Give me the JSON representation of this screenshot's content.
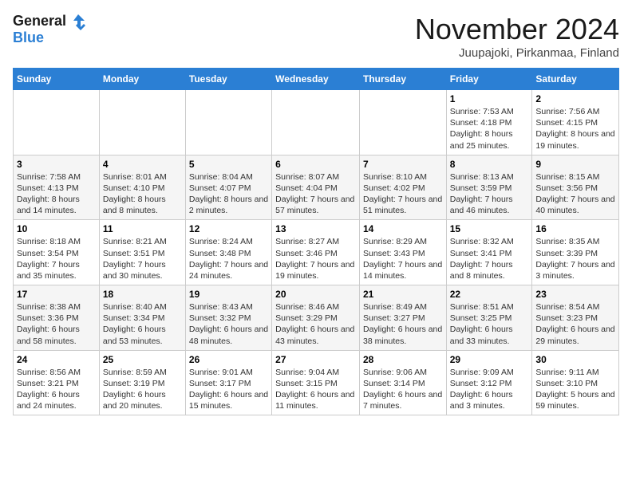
{
  "header": {
    "logo_text_general": "General",
    "logo_text_blue": "Blue",
    "month_title": "November 2024",
    "location": "Juupajoki, Pirkanmaa, Finland"
  },
  "calendar": {
    "days_of_week": [
      "Sunday",
      "Monday",
      "Tuesday",
      "Wednesday",
      "Thursday",
      "Friday",
      "Saturday"
    ],
    "weeks": [
      [
        {
          "day": "",
          "info": ""
        },
        {
          "day": "",
          "info": ""
        },
        {
          "day": "",
          "info": ""
        },
        {
          "day": "",
          "info": ""
        },
        {
          "day": "",
          "info": ""
        },
        {
          "day": "1",
          "info": "Sunrise: 7:53 AM\nSunset: 4:18 PM\nDaylight: 8 hours and 25 minutes."
        },
        {
          "day": "2",
          "info": "Sunrise: 7:56 AM\nSunset: 4:15 PM\nDaylight: 8 hours and 19 minutes."
        }
      ],
      [
        {
          "day": "3",
          "info": "Sunrise: 7:58 AM\nSunset: 4:13 PM\nDaylight: 8 hours and 14 minutes."
        },
        {
          "day": "4",
          "info": "Sunrise: 8:01 AM\nSunset: 4:10 PM\nDaylight: 8 hours and 8 minutes."
        },
        {
          "day": "5",
          "info": "Sunrise: 8:04 AM\nSunset: 4:07 PM\nDaylight: 8 hours and 2 minutes."
        },
        {
          "day": "6",
          "info": "Sunrise: 8:07 AM\nSunset: 4:04 PM\nDaylight: 7 hours and 57 minutes."
        },
        {
          "day": "7",
          "info": "Sunrise: 8:10 AM\nSunset: 4:02 PM\nDaylight: 7 hours and 51 minutes."
        },
        {
          "day": "8",
          "info": "Sunrise: 8:13 AM\nSunset: 3:59 PM\nDaylight: 7 hours and 46 minutes."
        },
        {
          "day": "9",
          "info": "Sunrise: 8:15 AM\nSunset: 3:56 PM\nDaylight: 7 hours and 40 minutes."
        }
      ],
      [
        {
          "day": "10",
          "info": "Sunrise: 8:18 AM\nSunset: 3:54 PM\nDaylight: 7 hours and 35 minutes."
        },
        {
          "day": "11",
          "info": "Sunrise: 8:21 AM\nSunset: 3:51 PM\nDaylight: 7 hours and 30 minutes."
        },
        {
          "day": "12",
          "info": "Sunrise: 8:24 AM\nSunset: 3:48 PM\nDaylight: 7 hours and 24 minutes."
        },
        {
          "day": "13",
          "info": "Sunrise: 8:27 AM\nSunset: 3:46 PM\nDaylight: 7 hours and 19 minutes."
        },
        {
          "day": "14",
          "info": "Sunrise: 8:29 AM\nSunset: 3:43 PM\nDaylight: 7 hours and 14 minutes."
        },
        {
          "day": "15",
          "info": "Sunrise: 8:32 AM\nSunset: 3:41 PM\nDaylight: 7 hours and 8 minutes."
        },
        {
          "day": "16",
          "info": "Sunrise: 8:35 AM\nSunset: 3:39 PM\nDaylight: 7 hours and 3 minutes."
        }
      ],
      [
        {
          "day": "17",
          "info": "Sunrise: 8:38 AM\nSunset: 3:36 PM\nDaylight: 6 hours and 58 minutes."
        },
        {
          "day": "18",
          "info": "Sunrise: 8:40 AM\nSunset: 3:34 PM\nDaylight: 6 hours and 53 minutes."
        },
        {
          "day": "19",
          "info": "Sunrise: 8:43 AM\nSunset: 3:32 PM\nDaylight: 6 hours and 48 minutes."
        },
        {
          "day": "20",
          "info": "Sunrise: 8:46 AM\nSunset: 3:29 PM\nDaylight: 6 hours and 43 minutes."
        },
        {
          "day": "21",
          "info": "Sunrise: 8:49 AM\nSunset: 3:27 PM\nDaylight: 6 hours and 38 minutes."
        },
        {
          "day": "22",
          "info": "Sunrise: 8:51 AM\nSunset: 3:25 PM\nDaylight: 6 hours and 33 minutes."
        },
        {
          "day": "23",
          "info": "Sunrise: 8:54 AM\nSunset: 3:23 PM\nDaylight: 6 hours and 29 minutes."
        }
      ],
      [
        {
          "day": "24",
          "info": "Sunrise: 8:56 AM\nSunset: 3:21 PM\nDaylight: 6 hours and 24 minutes."
        },
        {
          "day": "25",
          "info": "Sunrise: 8:59 AM\nSunset: 3:19 PM\nDaylight: 6 hours and 20 minutes."
        },
        {
          "day": "26",
          "info": "Sunrise: 9:01 AM\nSunset: 3:17 PM\nDaylight: 6 hours and 15 minutes."
        },
        {
          "day": "27",
          "info": "Sunrise: 9:04 AM\nSunset: 3:15 PM\nDaylight: 6 hours and 11 minutes."
        },
        {
          "day": "28",
          "info": "Sunrise: 9:06 AM\nSunset: 3:14 PM\nDaylight: 6 hours and 7 minutes."
        },
        {
          "day": "29",
          "info": "Sunrise: 9:09 AM\nSunset: 3:12 PM\nDaylight: 6 hours and 3 minutes."
        },
        {
          "day": "30",
          "info": "Sunrise: 9:11 AM\nSunset: 3:10 PM\nDaylight: 5 hours and 59 minutes."
        }
      ]
    ]
  }
}
